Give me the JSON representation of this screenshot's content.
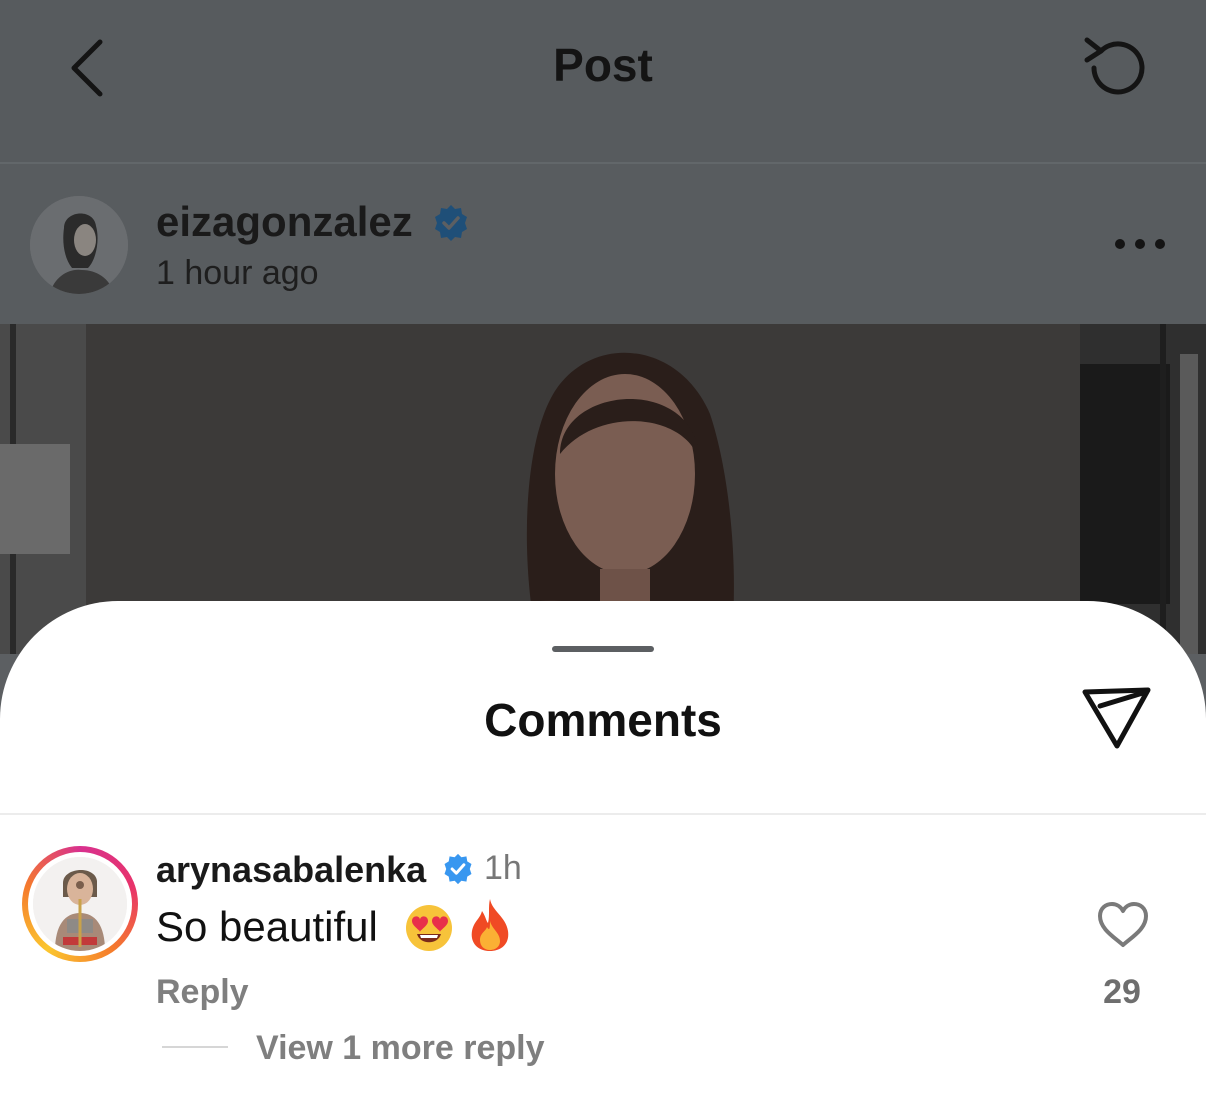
{
  "header": {
    "title": "Post",
    "back_icon": "chevron-left-icon",
    "refresh_icon": "refresh-icon"
  },
  "post": {
    "username": "eizagonzalez",
    "verified": true,
    "time": "1 hour ago",
    "more_icon": "more-horizontal-icon"
  },
  "comments_sheet": {
    "title": "Comments",
    "share_icon": "paper-plane-icon",
    "comments": [
      {
        "username": "arynasabalenka",
        "verified": true,
        "time": "1h",
        "text": "So beautiful",
        "emojis": [
          "heart-eyes-emoji",
          "fire-emoji"
        ],
        "reply_label": "Reply",
        "like_count": "29",
        "view_replies_label": "View 1 more reply",
        "has_story_ring": true
      }
    ]
  },
  "colors": {
    "backdrop": "#5c5f62",
    "verified_blue": "#3897f0",
    "secondary_text": "#7f7f7f"
  }
}
